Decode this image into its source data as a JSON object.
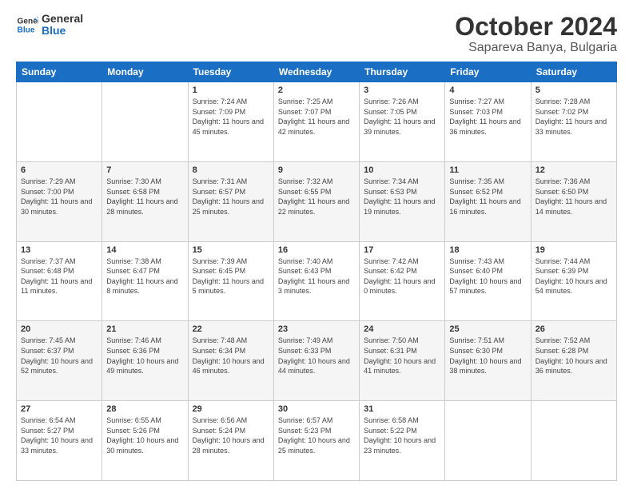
{
  "logo": {
    "line1": "General",
    "line2": "Blue"
  },
  "title": "October 2024",
  "subtitle": "Sapareva Banya, Bulgaria",
  "days_of_week": [
    "Sunday",
    "Monday",
    "Tuesday",
    "Wednesday",
    "Thursday",
    "Friday",
    "Saturday"
  ],
  "weeks": [
    [
      {
        "day": "",
        "info": ""
      },
      {
        "day": "",
        "info": ""
      },
      {
        "day": "1",
        "info": "Sunrise: 7:24 AM\nSunset: 7:09 PM\nDaylight: 11 hours and 45 minutes."
      },
      {
        "day": "2",
        "info": "Sunrise: 7:25 AM\nSunset: 7:07 PM\nDaylight: 11 hours and 42 minutes."
      },
      {
        "day": "3",
        "info": "Sunrise: 7:26 AM\nSunset: 7:05 PM\nDaylight: 11 hours and 39 minutes."
      },
      {
        "day": "4",
        "info": "Sunrise: 7:27 AM\nSunset: 7:03 PM\nDaylight: 11 hours and 36 minutes."
      },
      {
        "day": "5",
        "info": "Sunrise: 7:28 AM\nSunset: 7:02 PM\nDaylight: 11 hours and 33 minutes."
      }
    ],
    [
      {
        "day": "6",
        "info": "Sunrise: 7:29 AM\nSunset: 7:00 PM\nDaylight: 11 hours and 30 minutes."
      },
      {
        "day": "7",
        "info": "Sunrise: 7:30 AM\nSunset: 6:58 PM\nDaylight: 11 hours and 28 minutes."
      },
      {
        "day": "8",
        "info": "Sunrise: 7:31 AM\nSunset: 6:57 PM\nDaylight: 11 hours and 25 minutes."
      },
      {
        "day": "9",
        "info": "Sunrise: 7:32 AM\nSunset: 6:55 PM\nDaylight: 11 hours and 22 minutes."
      },
      {
        "day": "10",
        "info": "Sunrise: 7:34 AM\nSunset: 6:53 PM\nDaylight: 11 hours and 19 minutes."
      },
      {
        "day": "11",
        "info": "Sunrise: 7:35 AM\nSunset: 6:52 PM\nDaylight: 11 hours and 16 minutes."
      },
      {
        "day": "12",
        "info": "Sunrise: 7:36 AM\nSunset: 6:50 PM\nDaylight: 11 hours and 14 minutes."
      }
    ],
    [
      {
        "day": "13",
        "info": "Sunrise: 7:37 AM\nSunset: 6:48 PM\nDaylight: 11 hours and 11 minutes."
      },
      {
        "day": "14",
        "info": "Sunrise: 7:38 AM\nSunset: 6:47 PM\nDaylight: 11 hours and 8 minutes."
      },
      {
        "day": "15",
        "info": "Sunrise: 7:39 AM\nSunset: 6:45 PM\nDaylight: 11 hours and 5 minutes."
      },
      {
        "day": "16",
        "info": "Sunrise: 7:40 AM\nSunset: 6:43 PM\nDaylight: 11 hours and 3 minutes."
      },
      {
        "day": "17",
        "info": "Sunrise: 7:42 AM\nSunset: 6:42 PM\nDaylight: 11 hours and 0 minutes."
      },
      {
        "day": "18",
        "info": "Sunrise: 7:43 AM\nSunset: 6:40 PM\nDaylight: 10 hours and 57 minutes."
      },
      {
        "day": "19",
        "info": "Sunrise: 7:44 AM\nSunset: 6:39 PM\nDaylight: 10 hours and 54 minutes."
      }
    ],
    [
      {
        "day": "20",
        "info": "Sunrise: 7:45 AM\nSunset: 6:37 PM\nDaylight: 10 hours and 52 minutes."
      },
      {
        "day": "21",
        "info": "Sunrise: 7:46 AM\nSunset: 6:36 PM\nDaylight: 10 hours and 49 minutes."
      },
      {
        "day": "22",
        "info": "Sunrise: 7:48 AM\nSunset: 6:34 PM\nDaylight: 10 hours and 46 minutes."
      },
      {
        "day": "23",
        "info": "Sunrise: 7:49 AM\nSunset: 6:33 PM\nDaylight: 10 hours and 44 minutes."
      },
      {
        "day": "24",
        "info": "Sunrise: 7:50 AM\nSunset: 6:31 PM\nDaylight: 10 hours and 41 minutes."
      },
      {
        "day": "25",
        "info": "Sunrise: 7:51 AM\nSunset: 6:30 PM\nDaylight: 10 hours and 38 minutes."
      },
      {
        "day": "26",
        "info": "Sunrise: 7:52 AM\nSunset: 6:28 PM\nDaylight: 10 hours and 36 minutes."
      }
    ],
    [
      {
        "day": "27",
        "info": "Sunrise: 6:54 AM\nSunset: 5:27 PM\nDaylight: 10 hours and 33 minutes."
      },
      {
        "day": "28",
        "info": "Sunrise: 6:55 AM\nSunset: 5:26 PM\nDaylight: 10 hours and 30 minutes."
      },
      {
        "day": "29",
        "info": "Sunrise: 6:56 AM\nSunset: 5:24 PM\nDaylight: 10 hours and 28 minutes."
      },
      {
        "day": "30",
        "info": "Sunrise: 6:57 AM\nSunset: 5:23 PM\nDaylight: 10 hours and 25 minutes."
      },
      {
        "day": "31",
        "info": "Sunrise: 6:58 AM\nSunset: 5:22 PM\nDaylight: 10 hours and 23 minutes."
      },
      {
        "day": "",
        "info": ""
      },
      {
        "day": "",
        "info": ""
      }
    ]
  ]
}
